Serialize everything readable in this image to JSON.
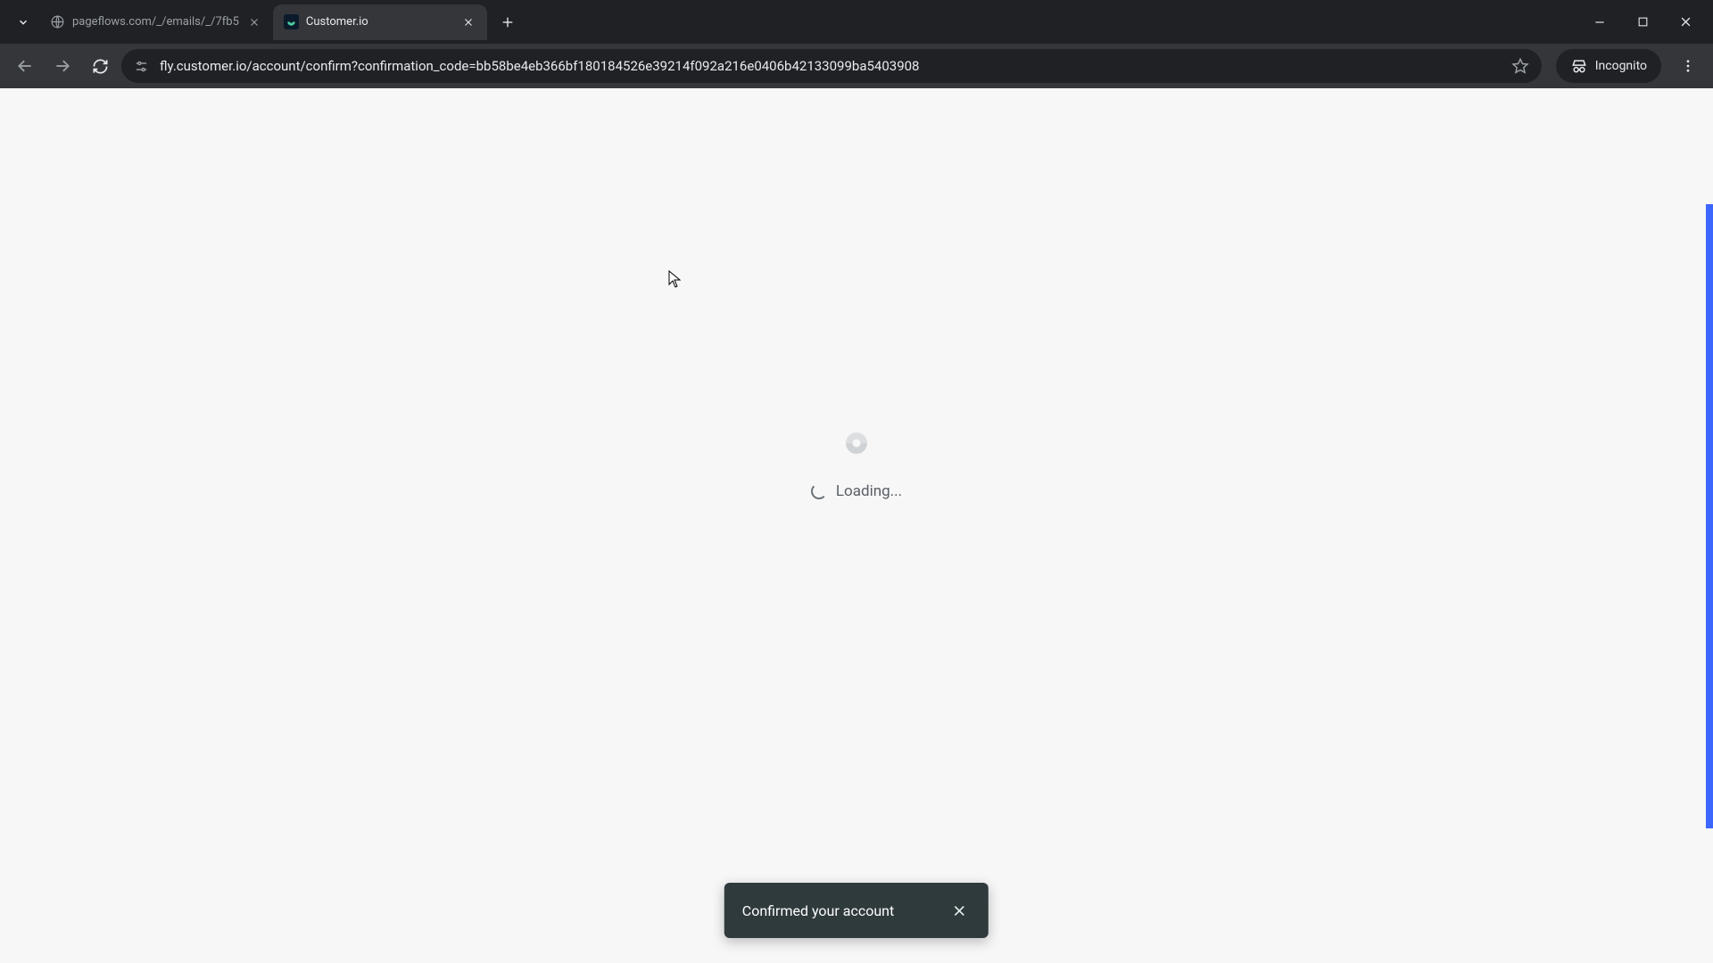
{
  "tabs": [
    {
      "title": "pageflows.com/_/emails/_/7fb5"
    },
    {
      "title": "Customer.io"
    }
  ],
  "url": "fly.customer.io/account/confirm?confirmation_code=bb58be4eb366bf180184526e39214f092a216e0406b42133099ba5403908",
  "incognito_label": "Incognito",
  "loading_text": "Loading...",
  "toast_message": "Confirmed your account"
}
